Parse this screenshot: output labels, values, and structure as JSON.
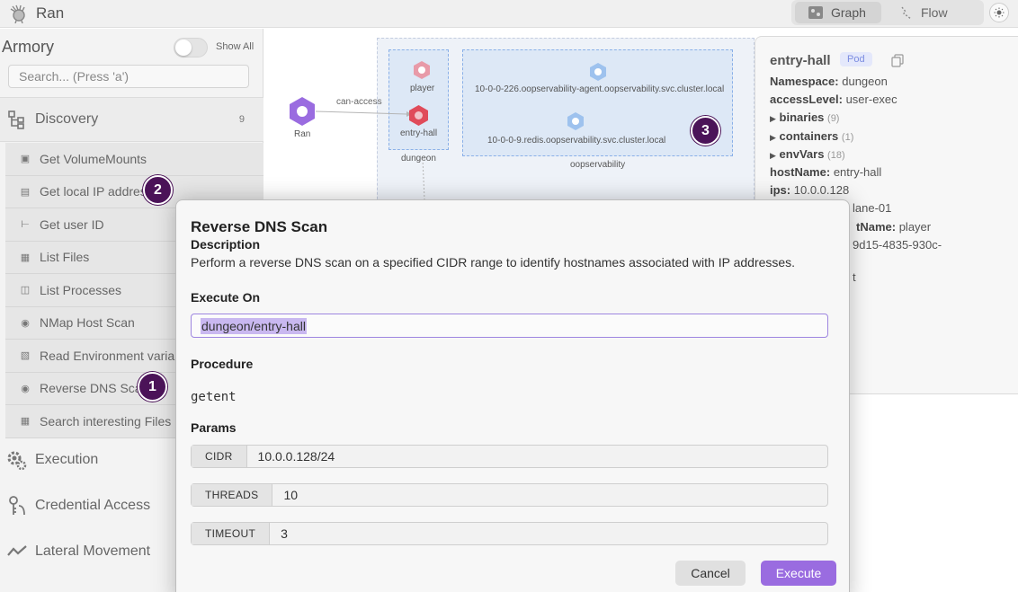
{
  "app": {
    "title": "Ran"
  },
  "view_toggle": {
    "graph_label": "Graph",
    "flow_label": "Flow"
  },
  "sidebar": {
    "title": "Armory",
    "show_all_label": "Show All",
    "search_placeholder": "Search... (Press 'a')",
    "discovery": {
      "label": "Discovery",
      "count": "9"
    },
    "items": [
      "Get VolumeMounts",
      "Get local IP address",
      "Get user ID",
      "List Files",
      "List Processes",
      "NMap Host Scan",
      "Read Environment variables",
      "Reverse DNS Scan",
      "Search interesting Files"
    ],
    "categories": [
      "Execution",
      "Credential Access",
      "Lateral Movement"
    ]
  },
  "graph": {
    "ran_label": "Ran",
    "edge_label": "can-access",
    "player_label": "player",
    "entry_hall_label": "entry-hall",
    "dungeon_label": "dungeon",
    "agent_label": "10-0-0-226.oopservability-agent.oopservability.svc.cluster.local",
    "redis_label": "10-0-0-9.redis.oopservability.svc.cluster.local",
    "oopservability_label": "oopservability"
  },
  "info": {
    "title": "entry-hall",
    "badge": "Pod",
    "namespace_key": "Namespace:",
    "namespace_val": "dungeon",
    "access_key": "accessLevel:",
    "access_val": "user-exec",
    "binaries_key": "binaries",
    "binaries_count": "(9)",
    "containers_key": "containers",
    "containers_count": "(1)",
    "envvars_key": "envVars",
    "envvars_count": "(18)",
    "hostname_key": "hostName:",
    "hostname_val": "entry-hall",
    "ips_key": "ips:",
    "ips_val": "10.0.0.128",
    "partial_1": "lane-01",
    "partial_2_key": "tName:",
    "partial_2_val": "player",
    "partial_3": "9d15-4835-930c-",
    "partial_4": "t"
  },
  "dialog": {
    "title": "Reverse DNS Scan",
    "description_heading": "Description",
    "description": "Perform a reverse DNS scan on a specified CIDR range to identify hostnames associated with IP addresses.",
    "execute_on_heading": "Execute On",
    "execute_on_value": "dungeon/entry-hall",
    "procedure_heading": "Procedure",
    "procedure": "getent",
    "params_heading": "Params",
    "params": [
      {
        "key": "CIDR",
        "value": "10.0.0.128/24"
      },
      {
        "key": "THREADS",
        "value": "10"
      },
      {
        "key": "TIMEOUT",
        "value": "3"
      }
    ],
    "cancel_label": "Cancel",
    "execute_label": "Execute"
  },
  "markers": [
    "1",
    "2",
    "3"
  ],
  "colors": {
    "accent": "#9a6ce0",
    "marker": "#4b1358",
    "node_red": "#e04b5a",
    "node_blue": "#5a8fe0"
  }
}
